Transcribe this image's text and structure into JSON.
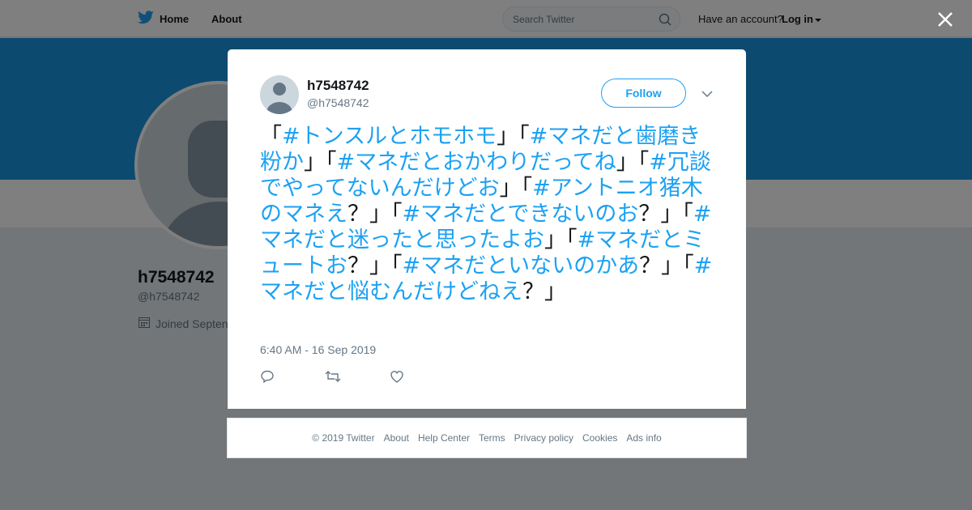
{
  "nav": {
    "home_label": "Home",
    "about_label": "About",
    "search_placeholder": "Search Twitter",
    "have_account": "Have an account?",
    "login_label": "Log in"
  },
  "profile": {
    "name": "h7548742",
    "handle": "@h7548742",
    "joined": "Joined Septen"
  },
  "tweet": {
    "name": "h7548742",
    "handle": "@h7548742",
    "follow_label": "Follow",
    "segments": [
      {
        "t": "「",
        "h": false
      },
      {
        "t": "#トンスルとホモホモ",
        "h": true
      },
      {
        "t": "」「",
        "h": false
      },
      {
        "t": "#マネだと歯磨き粉か",
        "h": true
      },
      {
        "t": "」「",
        "h": false
      },
      {
        "t": "#マネだとおかわりだってね",
        "h": true
      },
      {
        "t": "」「",
        "h": false
      },
      {
        "t": "#冗談でやってないんだけどお",
        "h": true
      },
      {
        "t": "」「",
        "h": false
      },
      {
        "t": "#アントニオ猪木のマネえ",
        "h": true
      },
      {
        "t": "？」「",
        "h": false
      },
      {
        "t": "#マネだとできないのお",
        "h": true
      },
      {
        "t": "？」「",
        "h": false
      },
      {
        "t": "#マネだと迷ったと思ったよお",
        "h": true
      },
      {
        "t": "」「",
        "h": false
      },
      {
        "t": "#マネだとミュートお",
        "h": true
      },
      {
        "t": "？」「",
        "h": false
      },
      {
        "t": "#マネだといないのかあ",
        "h": true
      },
      {
        "t": "？」「",
        "h": false
      },
      {
        "t": "#マネだと悩むんだけどねえ",
        "h": true
      },
      {
        "t": "？」",
        "h": false
      }
    ],
    "timestamp": "6:40 AM - 16 Sep 2019"
  },
  "footer": {
    "links": [
      "© 2019 Twitter",
      "About",
      "Help Center",
      "Terms",
      "Privacy policy",
      "Cookies",
      "Ads info"
    ]
  },
  "colors": {
    "brand": "#1da1f2",
    "banner": "#1b95e0",
    "text": "#14171a",
    "muted": "#657786"
  }
}
